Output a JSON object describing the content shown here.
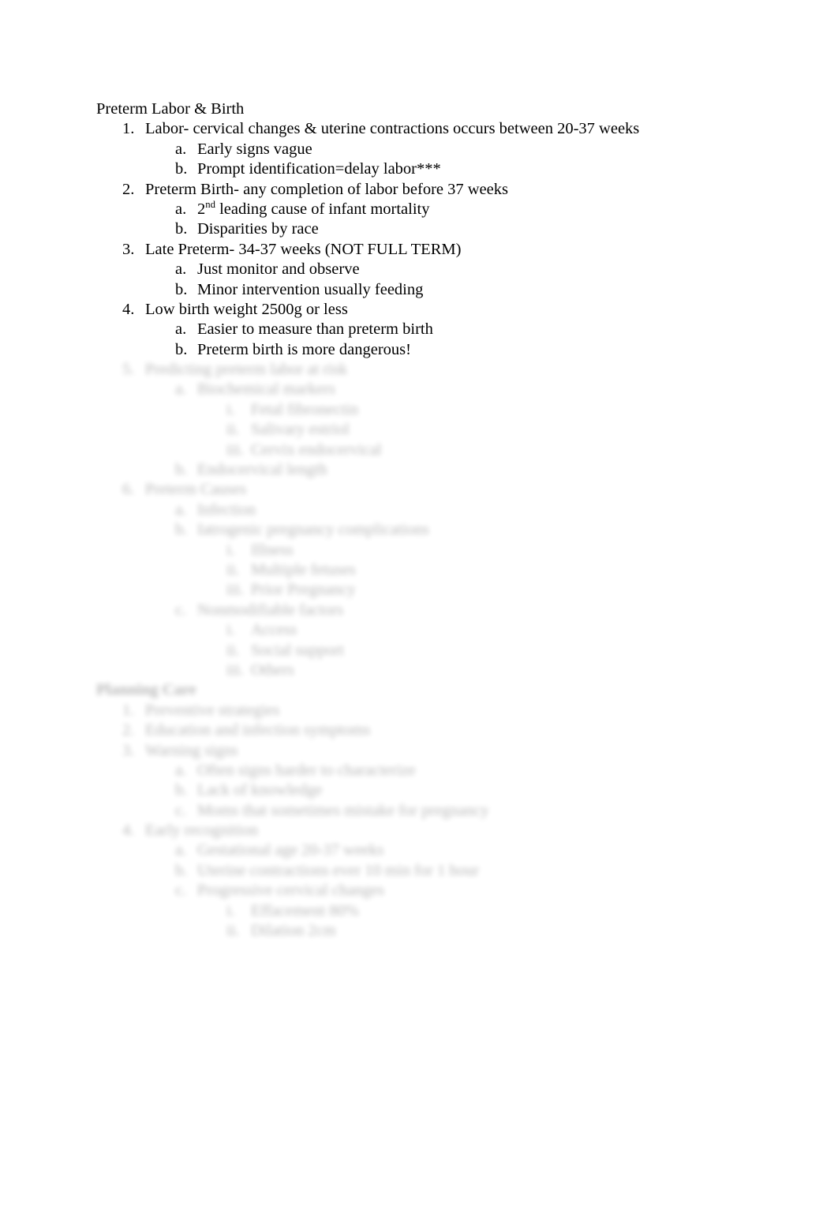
{
  "document": {
    "title": "Preterm Labor & Birth",
    "background_color": "#ffffff",
    "text_color": "#000000"
  },
  "content": {
    "heading": "Preterm Labor & Birth",
    "items": [
      {
        "marker": "1.",
        "text": "Labor- cervical changes & uterine contractions occurs between 20-37 weeks",
        "level": 1,
        "blurred": false
      },
      {
        "marker": "a.",
        "text": "Early signs vague",
        "level": 2,
        "blurred": false
      },
      {
        "marker": "b.",
        "text": "Prompt identification=delay labor***",
        "level": 2,
        "blurred": false
      },
      {
        "marker": "2.",
        "text": "Preterm Birth- any completion of labor before 37 weeks",
        "level": 1,
        "blurred": false
      },
      {
        "marker": "a.",
        "text_pre": "2",
        "text_sup": "nd",
        "text_post": " leading cause of infant mortality",
        "level": 2,
        "blurred": false,
        "has_superscript": true
      },
      {
        "marker": "b.",
        "text": "Disparities by race",
        "level": 2,
        "blurred": false
      },
      {
        "marker": "3.",
        "text": "Late Preterm- 34-37 weeks (NOT FULL TERM)",
        "level": 1,
        "blurred": false
      },
      {
        "marker": "a.",
        "text": "Just monitor and observe",
        "level": 2,
        "blurred": false
      },
      {
        "marker": "b.",
        "text": "Minor intervention usually feeding",
        "level": 2,
        "blurred": false
      },
      {
        "marker": "4.",
        "text": "Low birth weight 2500g or less",
        "level": 1,
        "blurred": false
      },
      {
        "marker": "a.",
        "text": "Easier to measure than preterm birth",
        "level": 2,
        "blurred": false
      },
      {
        "marker": "b.",
        "text": "Preterm birth is more dangerous!",
        "level": 2,
        "blurred": false
      }
    ],
    "obscured_note": "Remaining outline content below is blurred/illegible in the source scan."
  },
  "obscured_block_one": {
    "lines": [
      {
        "marker": "5.",
        "text": "Predicting preterm labor at risk",
        "level": 1
      },
      {
        "marker": "a.",
        "text": "Biochemical markers",
        "level": 2
      },
      {
        "marker": "i.",
        "text": "Fetal fibronectin",
        "level": 3
      },
      {
        "marker": "ii.",
        "text": "Salivary estriol",
        "level": 3
      },
      {
        "marker": "iii.",
        "text": "Cervix endocervical",
        "level": 3
      },
      {
        "marker": "b.",
        "text": "Endocervical length",
        "level": 2
      },
      {
        "marker": "6.",
        "text": "Preterm Causes",
        "level": 1
      },
      {
        "marker": "a.",
        "text": "Infection",
        "level": 2
      },
      {
        "marker": "b.",
        "text": "Iatrogenic pregnancy complications",
        "level": 2
      },
      {
        "marker": "i.",
        "text": "Illness",
        "level": 3
      },
      {
        "marker": "ii.",
        "text": "Multiple fetuses",
        "level": 3
      },
      {
        "marker": "iii.",
        "text": "Prior Pregnancy",
        "level": 3
      },
      {
        "marker": "c.",
        "text": "Nonmodifiable factors",
        "level": 2
      },
      {
        "marker": "i.",
        "text": "Access",
        "level": 3
      },
      {
        "marker": "ii.",
        "text": "Social support",
        "level": 3
      },
      {
        "marker": "iii.",
        "text": "Others",
        "level": 3
      }
    ]
  },
  "obscured_block_two": {
    "heading": "Planning Care",
    "lines": [
      {
        "marker": "1.",
        "text": "Preventive strategies",
        "level": 1
      },
      {
        "marker": "2.",
        "text": "Education and infection symptoms",
        "level": 1
      },
      {
        "marker": "3.",
        "text": "Warning signs",
        "level": 1
      },
      {
        "marker": "a.",
        "text": "Often signs harder to characterize",
        "level": 2
      },
      {
        "marker": "b.",
        "text": "Lack of knowledge",
        "level": 2
      },
      {
        "marker": "c.",
        "text": "Moms that sometimes mistake for pregnancy",
        "level": 2
      },
      {
        "marker": "4.",
        "text": "Early recognition",
        "level": 1
      },
      {
        "marker": "a.",
        "text": "Gestational age 20-37 weeks",
        "level": 2
      },
      {
        "marker": "b.",
        "text": "Uterine contractions ever 10 min for 1 hour",
        "level": 2
      },
      {
        "marker": "c.",
        "text": "Progressive cervical changes",
        "level": 2
      },
      {
        "marker": "i.",
        "text": "Effacement 80%",
        "level": 3
      },
      {
        "marker": "ii.",
        "text": "Dilation 2cm",
        "level": 3
      }
    ]
  }
}
